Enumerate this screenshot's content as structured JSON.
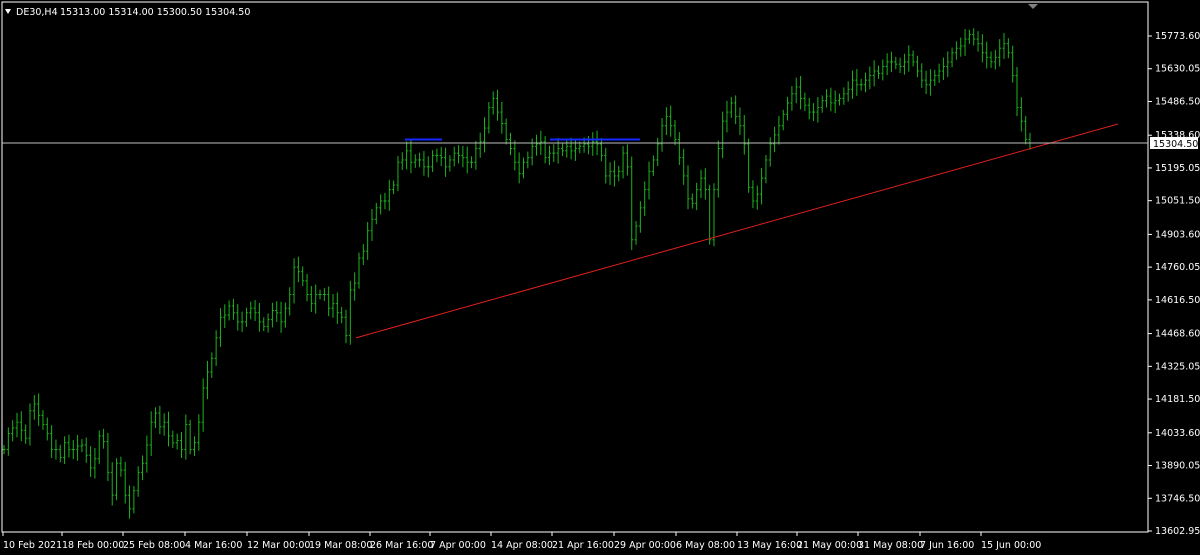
{
  "header": {
    "symbol": "DE30,H4",
    "ohlc": "15313.00 15314.00 15300.50 15304.50"
  },
  "colors": {
    "background": "#000000",
    "candles": "#1db31d",
    "axis": "#ffffff",
    "grid_frame": "#ffffff",
    "trendline": "#e0201c",
    "level_marks": "#1428ff",
    "price_line": "#c0c0c0"
  },
  "chart_data": {
    "type": "line",
    "instrument": "DE30",
    "timeframe": "H4",
    "x_labels": [
      "10 Feb 2021",
      "18 Feb 00:00",
      "25 Feb 08:00",
      "4 Mar 16:00",
      "12 Mar 00:00",
      "19 Mar 08:00",
      "26 Mar 16:00",
      "7 Apr 00:00",
      "14 Apr 08:00",
      "21 Apr 16:00",
      "29 Apr 00:00",
      "6 May 08:00",
      "13 May 16:00",
      "21 May 00:00",
      "31 May 08:00",
      "7 Jun 16:00",
      "15 Jun 00:00"
    ],
    "y_ticks": [
      "15773.60",
      "15630.05",
      "15486.50",
      "15338.60",
      "15195.05",
      "15051.50",
      "14903.60",
      "14760.05",
      "14616.50",
      "14468.60",
      "14325.05",
      "14181.50",
      "14033.60",
      "13890.05",
      "13746.50",
      "13602.95"
    ],
    "ylim": [
      13602.95,
      15917.15
    ],
    "current_price": "15304.50",
    "series": [
      {
        "values": [
          13960,
          14030,
          14055,
          14080,
          14045,
          14010,
          14130,
          14160,
          14110,
          14070,
          14030,
          13960,
          13960,
          13925,
          13990,
          13960,
          13960,
          13975,
          13980,
          13935,
          13880,
          13920,
          14020,
          13995,
          13860,
          13760,
          13900,
          13870,
          13760,
          13700,
          13780,
          13860,
          13900,
          13980,
          14080,
          14120,
          14060,
          14080,
          14020,
          13990,
          14000,
          13960,
          14070,
          13960,
          13990,
          14080,
          14230,
          14300,
          14360,
          14450,
          14540,
          14550,
          14590,
          14560,
          14520,
          14520,
          14560,
          14580,
          14560,
          14520,
          14500,
          14530,
          14570,
          14560,
          14520,
          14580,
          14640,
          14760,
          14740,
          14700,
          14640,
          14600,
          14640,
          14640,
          14640,
          14580,
          14600,
          14560,
          14540,
          14460,
          14660,
          14690,
          14800,
          14830,
          14920,
          14970,
          15020,
          15050,
          15050,
          15100,
          15120,
          15220,
          15230,
          15270,
          15220,
          15230,
          15230,
          15200,
          15200,
          15250,
          15250,
          15240,
          15200,
          15230,
          15260,
          15250,
          15240,
          15220,
          15220,
          15280,
          15310,
          15370,
          15460,
          15500,
          15440,
          15390,
          15320,
          15280,
          15220,
          15170,
          15220,
          15240,
          15290,
          15300,
          15310,
          15240,
          15260,
          15260,
          15280,
          15270,
          15290,
          15270,
          15280,
          15290,
          15300,
          15290,
          15310,
          15300,
          15250,
          15160,
          15180,
          15160,
          15180,
          15260,
          15200,
          14880,
          14940,
          15020,
          15100,
          15180,
          15230,
          15300,
          15380,
          15420,
          15380,
          15320,
          15240,
          15160,
          15060,
          15040,
          15100,
          15150,
          15100,
          14880,
          15100,
          15280,
          15400,
          15440,
          15480,
          15420,
          15380,
          15300,
          15110,
          15050,
          15080,
          15150,
          15230,
          15300,
          15340,
          15380,
          15430,
          15480,
          15520,
          15550,
          15500,
          15470,
          15440,
          15440,
          15460,
          15490,
          15510,
          15480,
          15490,
          15500,
          15520,
          15540,
          15580,
          15560,
          15560,
          15580,
          15600,
          15620,
          15610,
          15640,
          15660,
          15660,
          15650,
          15640,
          15660,
          15690,
          15660,
          15620,
          15580,
          15560,
          15580,
          15600,
          15620,
          15640,
          15660,
          15700,
          15720,
          15730,
          15760,
          15780,
          15760,
          15740,
          15700,
          15680,
          15660,
          15680,
          15720,
          15740,
          15700,
          15600,
          15460,
          15400,
          15320,
          15304.5
        ]
      }
    ],
    "trendline": {
      "from": [
        "19 Mar 08:00",
        14450
      ],
      "to": [
        "15 Jun 00:00",
        15310
      ]
    },
    "resistance_marks": [
      15320,
      15320,
      15320
    ],
    "grid": false,
    "legend": "none"
  }
}
